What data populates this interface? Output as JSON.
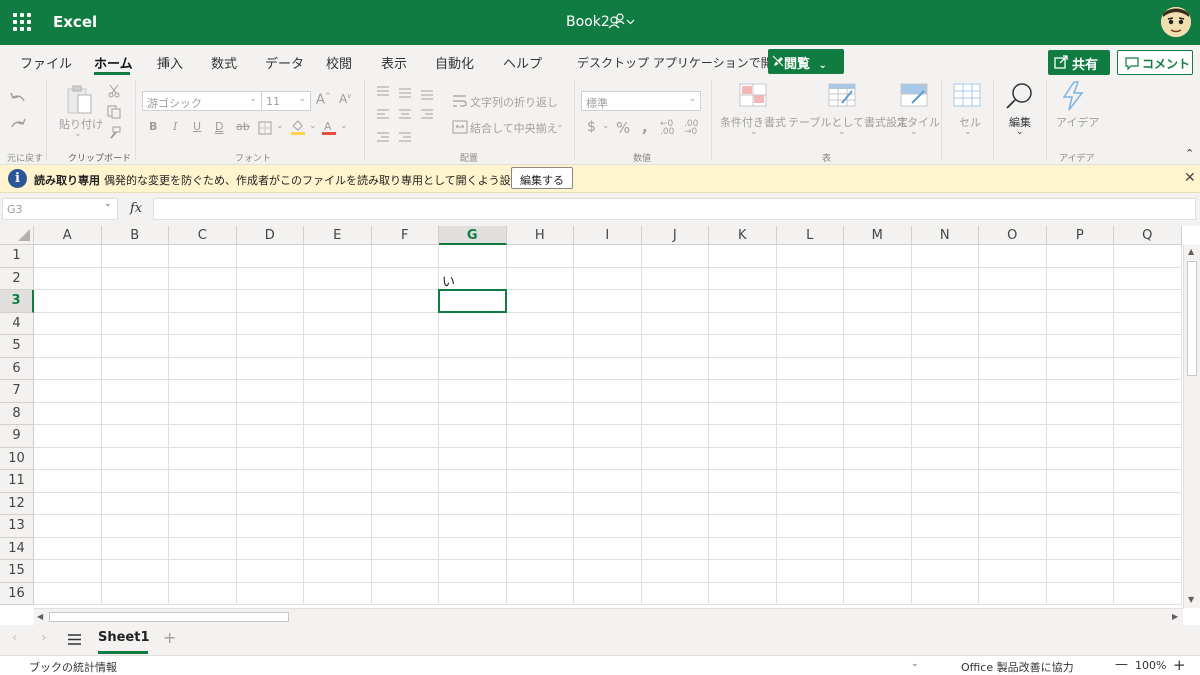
{
  "titlebar": {
    "app_name": "Excel",
    "doc_title": "Book2"
  },
  "tabs": [
    {
      "label": "ファイル",
      "active": false
    },
    {
      "label": "ホーム",
      "active": true
    },
    {
      "label": "挿入",
      "active": false
    },
    {
      "label": "数式",
      "active": false
    },
    {
      "label": "データ",
      "active": false
    },
    {
      "label": "校閲",
      "active": false
    },
    {
      "label": "表示",
      "active": false
    },
    {
      "label": "自動化",
      "active": false
    },
    {
      "label": "ヘルプ",
      "active": false
    },
    {
      "label": "デスクトップ アプリケーションで開く",
      "active": false
    }
  ],
  "actions": {
    "view_label": "閲覧",
    "share_label": "共有",
    "comment_label": "コメント"
  },
  "ribbon": {
    "undo_group_label": "元に戻す",
    "clipboard": {
      "paste_label": "貼り付け",
      "group_label": "クリップボード"
    },
    "font": {
      "name": "游ゴシック",
      "size": "11",
      "group_label": "フォント"
    },
    "alignment": {
      "wrap_label": "文字列の折り返し",
      "merge_label": "結合して中央揃え",
      "group_label": "配置"
    },
    "number": {
      "format": "標準",
      "group_label": "数値"
    },
    "table": {
      "conditional_label": "条件付き書式",
      "format_table_label": "テーブルとして書式設定",
      "style_label": "スタイル",
      "group_label": "表"
    },
    "cells": {
      "label": "セル"
    },
    "editing": {
      "label": "編集"
    },
    "ideas": {
      "label": "アイデア",
      "group_label": "アイデア"
    }
  },
  "infobar": {
    "title": "読み取り専用",
    "message": "偶発的な変更を防ぐため、作成者がこのファイルを読み取り専用として開くよう設定しました",
    "edit_button": "編集する"
  },
  "formula_bar": {
    "name_box": "G3",
    "fx_label": "fx",
    "formula": ""
  },
  "grid": {
    "columns": [
      "A",
      "B",
      "C",
      "D",
      "E",
      "F",
      "G",
      "H",
      "I",
      "J",
      "K",
      "L",
      "M",
      "N",
      "O",
      "P",
      "Q"
    ],
    "rows": [
      "1",
      "2",
      "3",
      "4",
      "5",
      "6",
      "7",
      "8",
      "9",
      "10",
      "11",
      "12",
      "13",
      "14",
      "15",
      "16"
    ],
    "selected_column": "G",
    "selected_row": "3",
    "cells": [
      {
        "ref": "G2",
        "value": "い"
      }
    ]
  },
  "sheets": {
    "active": "Sheet1",
    "add_label": "+"
  },
  "statusbar": {
    "left": "ブックの統計情報",
    "feedback": "Office 製品改善に協力",
    "zoom": "100%"
  },
  "colors": {
    "brand": "#107c41",
    "infobar_bg": "#fff4ce"
  }
}
